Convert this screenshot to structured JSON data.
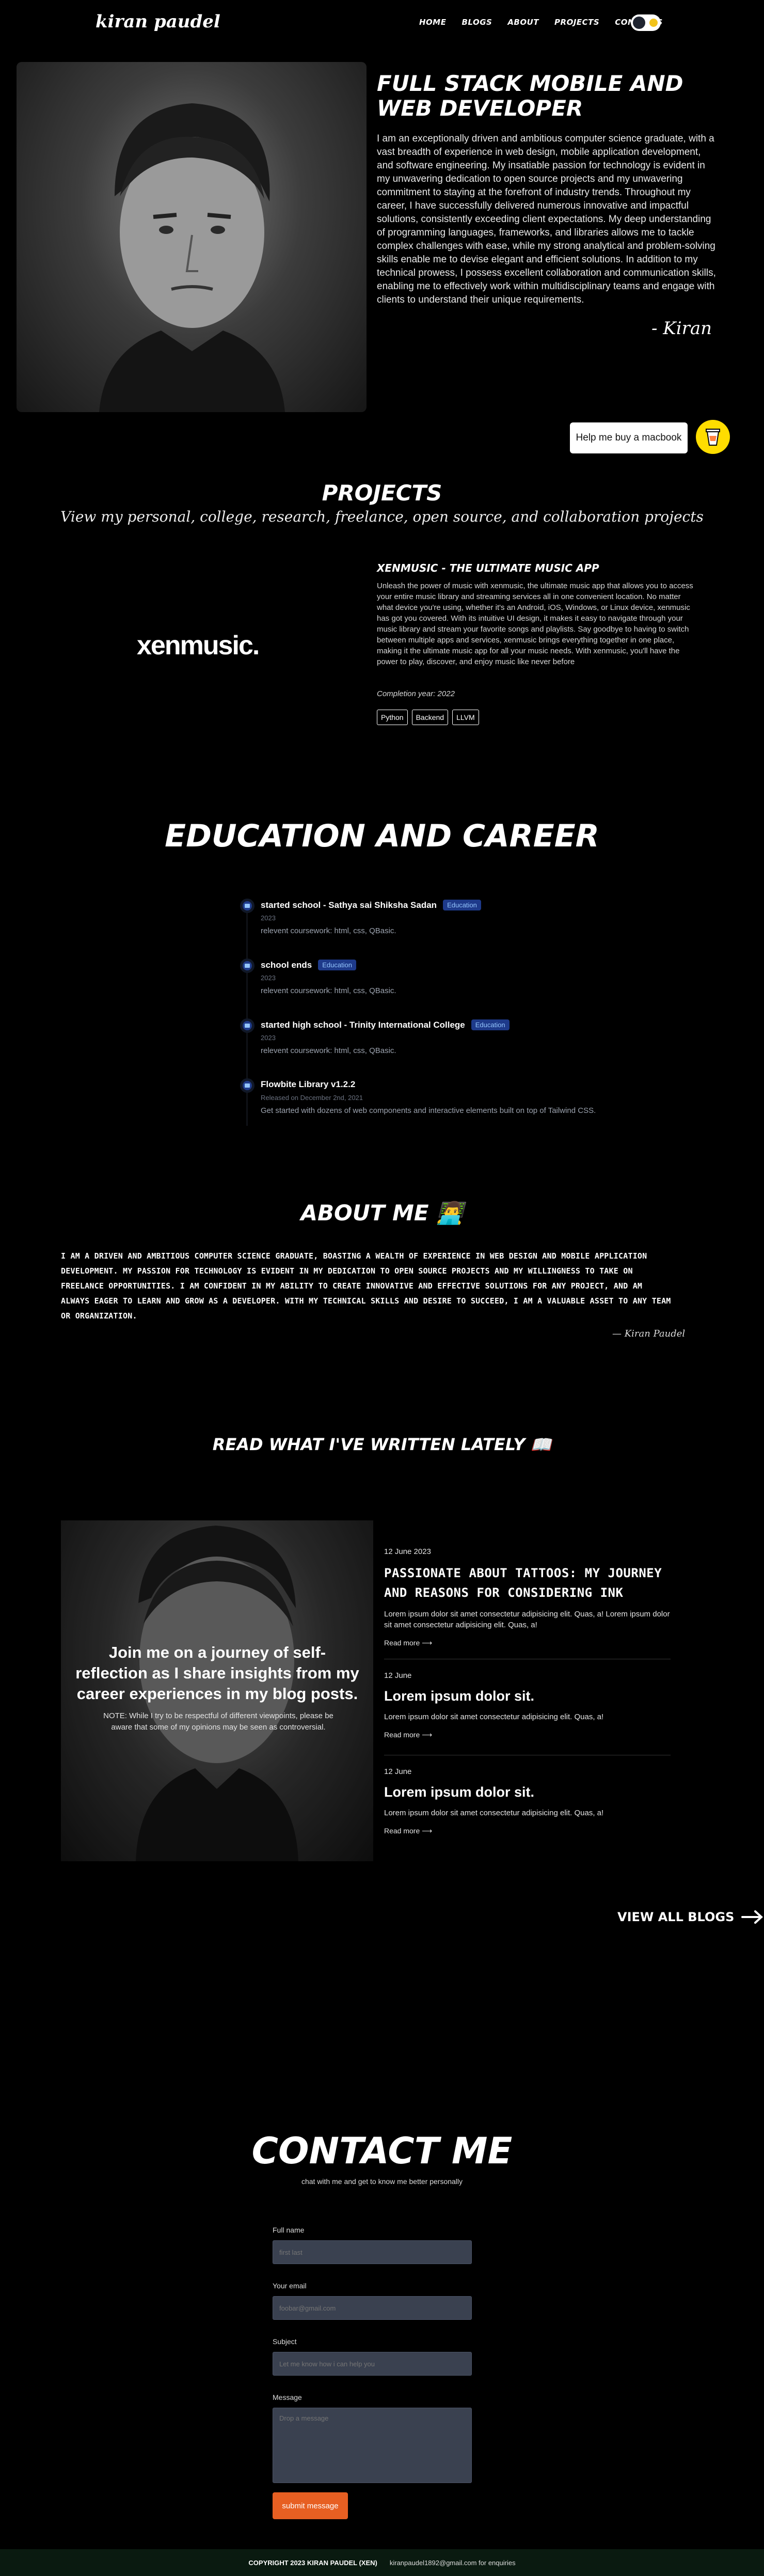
{
  "nav": {
    "logo": "kiran paudel",
    "links": [
      "HOME",
      "BLOGS",
      "ABOUT",
      "PROJECTS",
      "CONTACTS"
    ]
  },
  "hero": {
    "title": "FULL STACK MOBILE AND WEB DEVELOPER",
    "bio": "I am an exceptionally driven and ambitious computer science graduate, with a vast breadth of experience in web design, mobile application development, and software engineering. My insatiable passion for technology is evident in my unwavering dedication to open source projects and my unwavering commitment to staying at the forefront of industry trends. Throughout my career, I have successfully delivered numerous innovative and impactful solutions, consistently exceeding client expectations. My deep understanding of programming languages, frameworks, and libraries allows me to tackle complex challenges with ease, while my strong analytical and problem-solving skills enable me to devise elegant and efficient solutions. In addition to my technical prowess, I possess excellent collaboration and communication skills, enabling me to effectively work within multidisciplinary teams and engage with clients to understand their unique requirements.",
    "signature": "- Kiran"
  },
  "coffee": {
    "label": "Help me buy a macbook"
  },
  "projects": {
    "title": "PROJECTS",
    "subtitle": "View my personal, college, research, freelance, open source, and collaboration projects",
    "items": [
      {
        "logo": "xenmusic.",
        "name": "XENMUSIC - THE ULTIMATE MUSIC APP",
        "description": "Unleash the power of music with xenmusic, the ultimate music app that allows you to access your entire music library and streaming services all in one convenient location. No matter what device you're using, whether it's an Android, iOS, Windows, or Linux device, xenmusic has got you covered. With its intuitive UI design, it makes it easy to navigate through your music library and stream your favorite songs and playlists. Say goodbye to having to switch between multiple apps and services, xenmusic brings everything together in one place, making it the ultimate music app for all your music needs. With xenmusic, you'll have the power to play, discover, and enjoy music like never before",
        "year": "Completion year: 2022",
        "tags": [
          "Python",
          "Backend",
          "LLVM"
        ]
      }
    ]
  },
  "education": {
    "title": "EDUCATION AND CAREER",
    "items": [
      {
        "name": "started school - Sathya sai Shiksha Sadan",
        "badge": "Education",
        "date": "2023",
        "text": "relevent coursework: html, css, QBasic."
      },
      {
        "name": "school ends",
        "badge": "Education",
        "date": "2023",
        "text": "relevent coursework: html, css, QBasic."
      },
      {
        "name": "started high school - Trinity International College",
        "badge": "Education",
        "date": "2023",
        "text": "relevent coursework: html, css, QBasic."
      },
      {
        "name": "Flowbite Library v1.2.2",
        "badge": "",
        "date": "Released on December 2nd, 2021",
        "text": "Get started with dozens of web components and interactive elements built on top of Tailwind CSS."
      }
    ]
  },
  "about": {
    "title": "ABOUT ME 👨‍💻",
    "body": "I am a driven and ambitious computer science graduate, boasting a wealth of experience in web design and mobile application development. My passion for technology is evident in my dedication to open source projects and my willingness to take on freelance opportunities. I am confident in my ability to create innovative and effective solutions for any project, and am always eager to learn and grow as a developer. With my technical skills and desire to succeed, I am a valuable asset to any team or organization.",
    "signature": "— Kiran Paudel"
  },
  "blogs": {
    "title": "READ WHAT I'VE WRITTEN LATELY 📖",
    "feature": {
      "title": "Join me on a journey of self-reflection as I share insights from my career experiences in my blog posts.",
      "note": "NOTE: While I try to be respectful of different viewpoints, please be aware that some of my opinions may be seen as controversial."
    },
    "posts": [
      {
        "date": "12 June 2023",
        "title": "PASSIONATE ABOUT TATTOOS: MY JOURNEY AND REASONS FOR CONSIDERING INK",
        "excerpt": "Lorem ipsum dolor sit amet consectetur adipisicing elit. Quas, a! Lorem ipsum dolor sit amet consectetur adipisicing elit. Quas, a!",
        "more": "Read more"
      },
      {
        "date": "12 June",
        "title": "Lorem ipsum dolor sit.",
        "excerpt": "Lorem ipsum dolor sit amet consectetur adipisicing elit. Quas, a!",
        "more": "Read more"
      },
      {
        "date": "12 June",
        "title": "Lorem ipsum dolor sit.",
        "excerpt": "Lorem ipsum dolor sit amet consectetur adipisicing elit. Quas, a!",
        "more": "Read more"
      }
    ],
    "view_all": "VIEW ALL BLOGS"
  },
  "contact": {
    "title": "CONTACT ME",
    "subtitle": "chat with me and get to know me better personally",
    "fields": {
      "name_label": "Full name",
      "name_placeholder": "first last",
      "email_label": "Your email",
      "email_placeholder": "foobar@gmail.com",
      "subject_label": "Subject",
      "subject_placeholder": "Let me know how i can help you",
      "message_label": "Message",
      "message_placeholder": "Drop a message"
    },
    "submit": "submit message"
  },
  "footer": {
    "copyright": "COPYRIGHT 2023 KIRAN PAUDEL (XEN)",
    "email": "kiranpaudel1892@gmail.com for enquiries"
  },
  "colors": {
    "background": "#000000",
    "badge": "#1e3a8a",
    "submit": "#e75f22",
    "coffee": "#ffdd00",
    "footer": "#0a1a10"
  }
}
